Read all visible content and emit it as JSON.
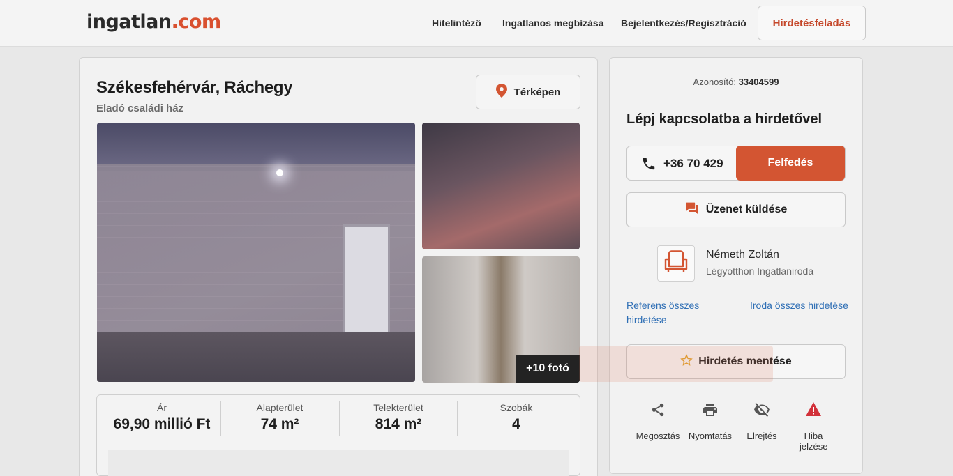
{
  "header": {
    "logo_main": "ingatlan",
    "logo_tld": ".com",
    "nav": [
      "Hitelintéző",
      "Ingatlanos megbízása",
      "Bejelentkezés/Regisztráció"
    ],
    "post_button": "Hirdetésfeladás"
  },
  "listing": {
    "title": "Székesfehérvár, Ráchegy",
    "subtitle": "Eladó családi ház",
    "map_button": "Térképen",
    "more_photos": "+10 fotó",
    "stats": [
      {
        "label": "Ár",
        "value": "69,90 millió Ft"
      },
      {
        "label": "Alapterület",
        "value": "74 m²"
      },
      {
        "label": "Telekterület",
        "value": "814 m²"
      },
      {
        "label": "Szobák",
        "value": "4"
      }
    ]
  },
  "sidebar": {
    "id_label": "Azonosító:",
    "id_value": "33404599",
    "contact_title": "Lépj kapcsolatba a hirdetővel",
    "phone": "+36 70 429",
    "reveal_button": "Felfedés",
    "message_button": "Üzenet küldése",
    "agent_name": "Németh Zoltán",
    "agent_office": "Légyotthon Ingatlaniroda",
    "link_agent_all": "Referens összes hirdetése",
    "link_office_all": "Iroda összes hirdetése",
    "save_button": "Hirdetés mentése",
    "actions": [
      "Megosztás",
      "Nyomtatás",
      "Elrejtés",
      "Hiba jelzése"
    ]
  },
  "colors": {
    "accent": "#d35532",
    "link": "#2f6fb5",
    "warning": "#d2313a"
  }
}
